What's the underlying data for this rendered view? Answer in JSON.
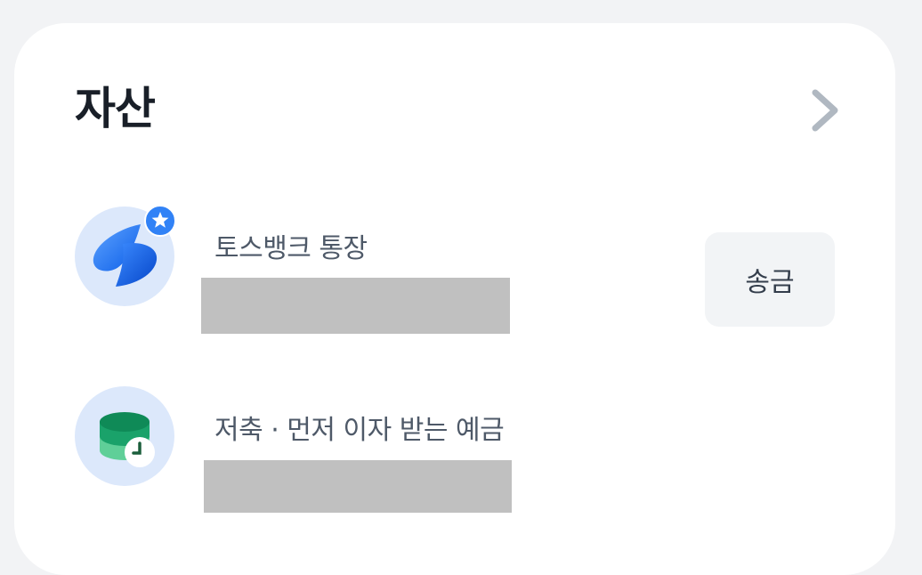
{
  "assets": {
    "title": "자산",
    "accounts": [
      {
        "name": "토스뱅크 통장",
        "icon": "tossbank-logo-icon",
        "badge_icon": "star-badge-icon",
        "action_label": "송금"
      },
      {
        "name": "저축 · 먼저 이자 받는 예금",
        "icon": "savings-coins-clock-icon"
      }
    ]
  },
  "colors": {
    "background": "#f2f3f5",
    "card": "#ffffff",
    "title": "#191f28",
    "label": "#4e5968",
    "chevron": "#b0b8c1",
    "avatar_bg": "#dce8fb",
    "brand_blue": "#3182f6",
    "savings_green": "#1aa26a",
    "masked": "#c0c0c0",
    "button_bg": "#f2f4f6"
  }
}
